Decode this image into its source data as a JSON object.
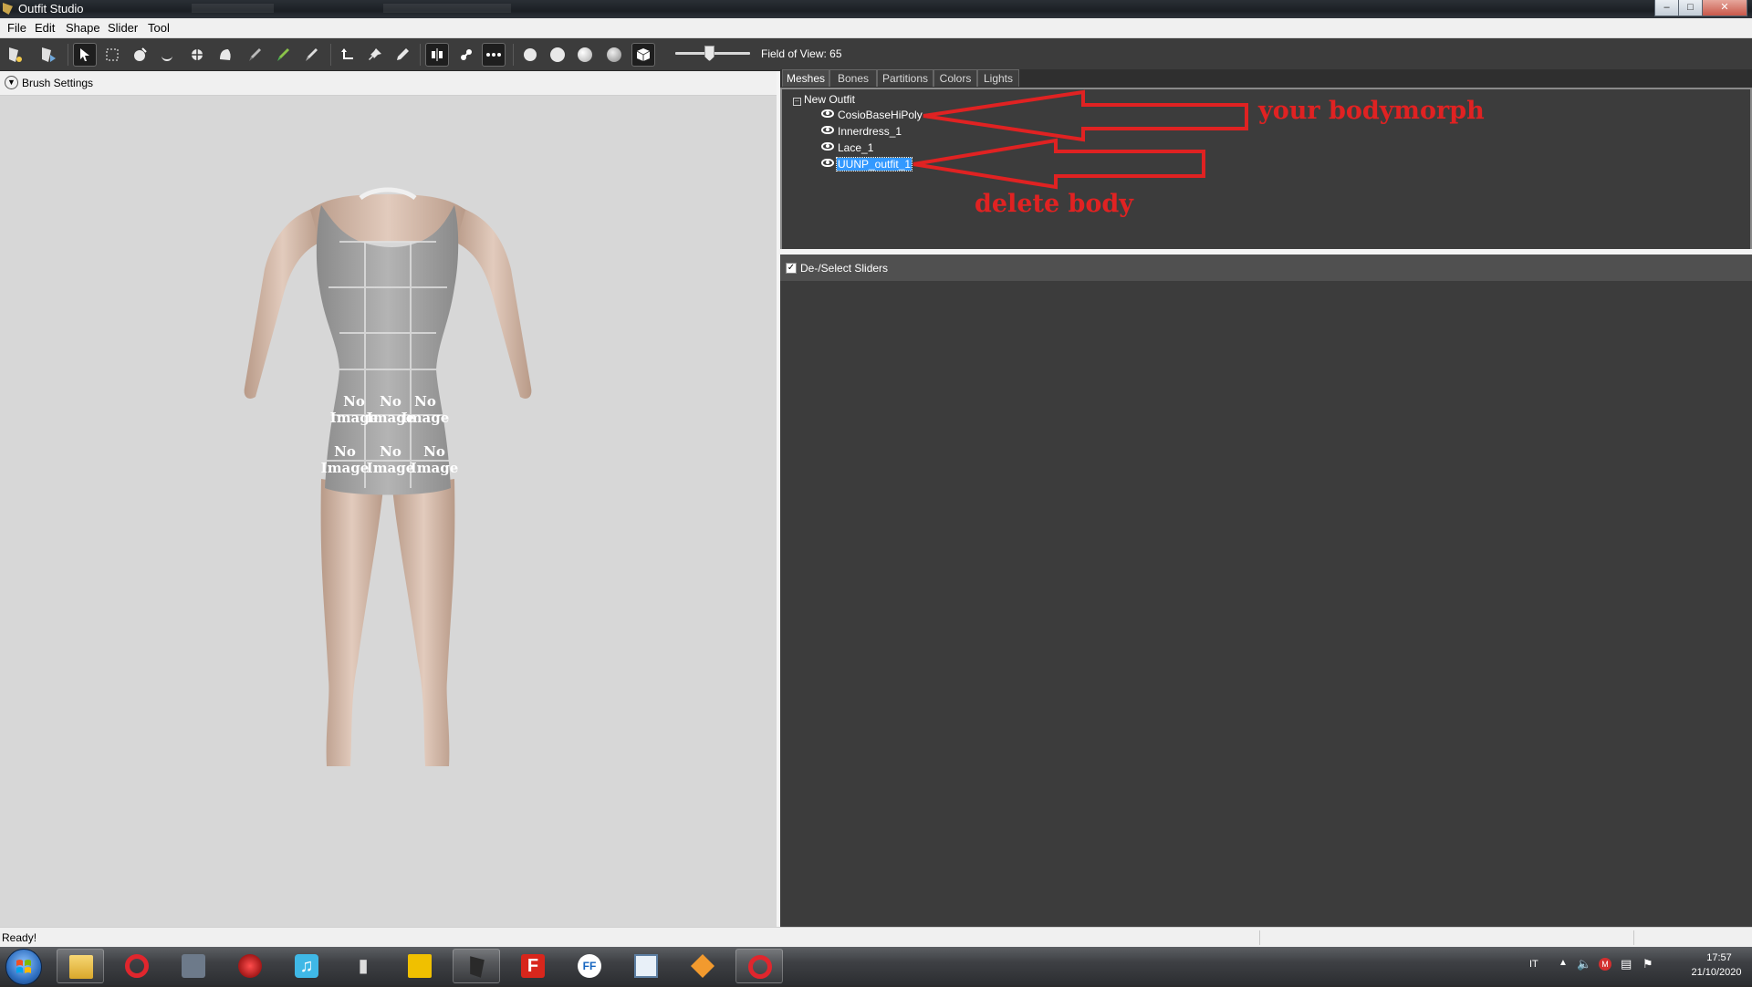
{
  "window": {
    "title": "Outfit Studio"
  },
  "menu": [
    "File",
    "Edit",
    "Shape",
    "Slider",
    "Tool"
  ],
  "toolbar": {
    "fov_label": "Field of View: 65",
    "fov_value": 65
  },
  "brush": {
    "label": "Brush Settings"
  },
  "tabs": [
    "Meshes",
    "Bones",
    "Partitions",
    "Colors",
    "Lights"
  ],
  "tree": {
    "root": "New Outfit",
    "items": [
      "CosioBaseHiPoly",
      "Innerdress_1",
      "Lace_1",
      "UUNP_outfit_1"
    ],
    "selected": "UUNP_outfit_1"
  },
  "sliders": {
    "label": "De-/Select Sliders",
    "checked": true
  },
  "annotations": {
    "top": "your bodymorph",
    "bottom": "delete body",
    "color": "#e02222"
  },
  "viewport": {
    "tile_text_1": "No",
    "tile_text_2": "Image"
  },
  "status": {
    "text": "Ready!"
  },
  "taskbar": {
    "lang": "IT",
    "tray_badge": "M",
    "time": "17:57",
    "date": "21/10/2020",
    "apps": [
      "file-explorer",
      "opera",
      "game-controller",
      "steam-like",
      "music",
      "audio-editor",
      "lol-folder",
      "outfit-studio",
      "flash",
      "ffdec",
      "notepad",
      "mixer",
      "opera-active"
    ]
  },
  "colors": {
    "accent": "#3399ff",
    "panel": "#3c3c3c",
    "viewport": "#d7d7d7"
  }
}
